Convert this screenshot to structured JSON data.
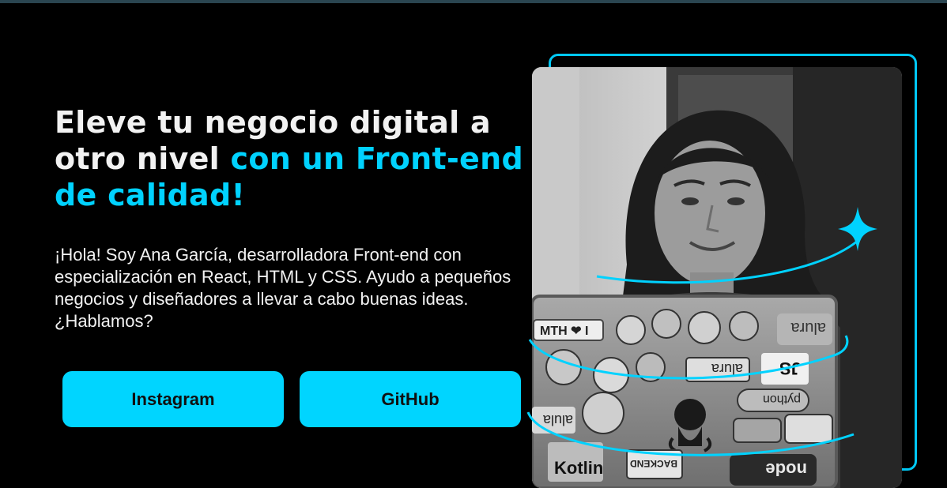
{
  "hero": {
    "headline_part1": "Eleve tu negocio digital a otro nivel ",
    "headline_accent": "con un Front-end de calidad!",
    "intro": "¡Hola! Soy Ana García, desarrolladora Front-end con especialización en React, HTML y CSS. Ayudo a pequeños negocios y diseñadores a llevar a cabo buenas ideas. ¿Hablamos?",
    "buttons": {
      "instagram_label": "Instagram",
      "github_label": "GitHub"
    }
  },
  "photo": {
    "sticker_texts": [
      "MTH ❤ I",
      "alura",
      "alura",
      "JS",
      "python",
      "alura",
      "BACKEND",
      "node",
      "Kotlin",
      "alula"
    ]
  },
  "colors": {
    "background": "#000000",
    "accent": "#00d5ff",
    "text": "#f2f2f2"
  },
  "icons": {
    "sparkle": "sparkle-icon",
    "github_octocat": "github-octocat-sticker"
  }
}
